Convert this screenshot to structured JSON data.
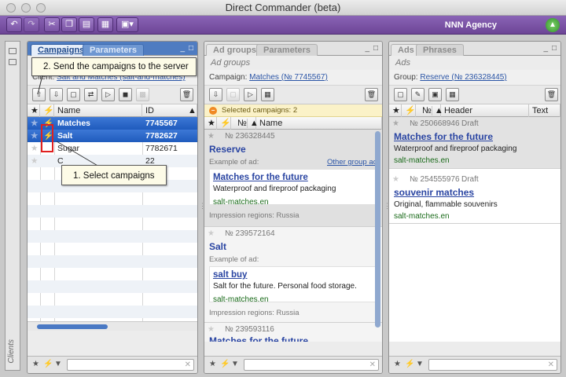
{
  "window": {
    "title": "Direct Commander (beta)"
  },
  "toolbar": {
    "agency": "NNN Agency",
    "icons": [
      "undo-icon",
      "redo-icon",
      "cut-icon",
      "copy-icon",
      "paste-icon",
      "columns-icon",
      "view-menu-icon",
      "sync-icon"
    ]
  },
  "sidebar": {
    "label": "Clients"
  },
  "campaigns_panel": {
    "tabs": [
      "Campaigns",
      "Parameters"
    ],
    "client_label": "Client:",
    "client_value": "Salt and Matches (salt-and-matches)",
    "client_value_visible": "Matches (salt-and-matches)",
    "columns": [
      "Name",
      "ID"
    ],
    "rows": [
      {
        "name": "Matches",
        "id": "7745567",
        "selected": true
      },
      {
        "name": "Salt",
        "id": "7782627",
        "selected": true
      },
      {
        "name": "Sugar",
        "id": "7782671",
        "selected": false
      },
      {
        "name": "C",
        "id": "22",
        "selected": false
      }
    ]
  },
  "adgroups_panel": {
    "tabs": [
      "Ad groups",
      "Parameters"
    ],
    "subtitle": "Ad groups",
    "campaign_label": "Campaign:",
    "campaign_value": "Matches (№ 7745567)",
    "notice": "Selected campaigns: 2",
    "columns": [
      "№",
      "Name"
    ],
    "groups": [
      {
        "number": "№ 236328445",
        "name": "Reserve",
        "example_label": "Example of ad:",
        "other_link": "Other group ac",
        "ad_header": "Matches for the future",
        "ad_text": "Waterproof and fireproof packaging",
        "ad_url": "salt-matches.en",
        "regions": "Impression regions: Russia"
      },
      {
        "number": "№ 239572164",
        "name": "Salt",
        "example_label": "Example of ad:",
        "ad_header": "salt buy",
        "ad_text": "Salt for the future. Personal food storage.",
        "ad_url": "salt-matches.en",
        "regions": "Impression regions: Russia"
      },
      {
        "number": "№ 239593116",
        "name": "Matches for the future"
      }
    ]
  },
  "ads_panel": {
    "tabs": [
      "Ads",
      "Phrases"
    ],
    "subtitle": "Ads",
    "group_label": "Group:",
    "group_value": "Reserve (№ 236328445)",
    "columns": [
      "№",
      "Header",
      "Text"
    ],
    "ads": [
      {
        "number": "№ 250668946",
        "status": "Draft",
        "header": "Matches for the future",
        "text": "Waterproof and fireproof packaging",
        "url": "salt-matches.en"
      },
      {
        "number": "№ 254555976",
        "status": "Draft",
        "header": "souvenir matches",
        "text": "Original, flammable souvenirs",
        "url": "salt-matches.en"
      }
    ]
  },
  "callouts": {
    "send": "2. Send the campaigns to the server",
    "select": "1. Select campaigns"
  },
  "colors": {
    "toolbar": "#7a53a4",
    "selection": "#2a62c6",
    "link": "#2a45a2",
    "url": "#196a19",
    "highlight": "#e02020"
  }
}
